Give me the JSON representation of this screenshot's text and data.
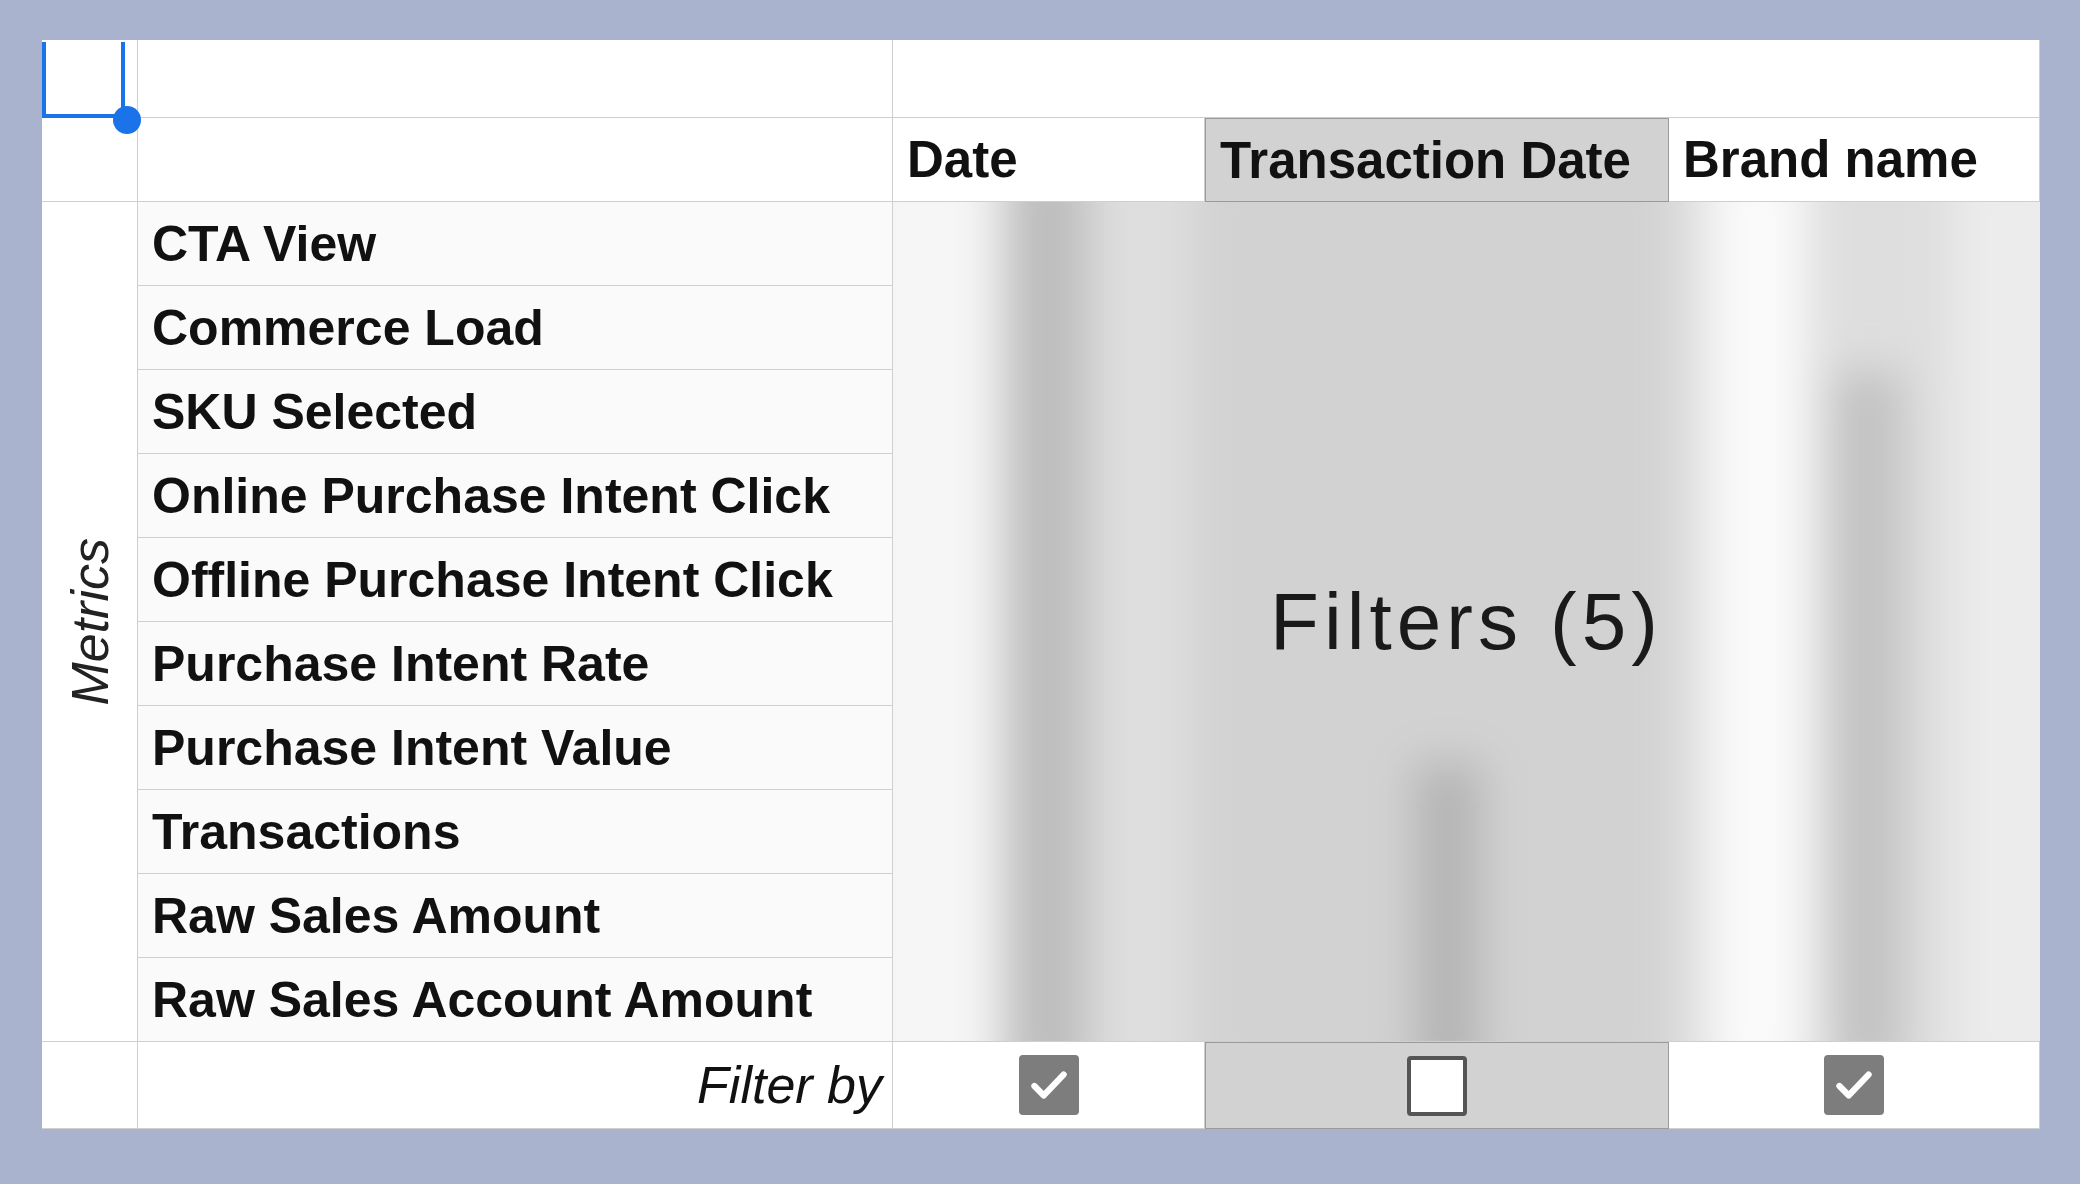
{
  "row_group": {
    "label": "Metrics"
  },
  "columns": [
    {
      "label": "Date",
      "selected": false,
      "filter_checked": true
    },
    {
      "label": "Transaction Date",
      "selected": true,
      "filter_checked": false
    },
    {
      "label": "Brand name",
      "selected": false,
      "filter_checked": true
    }
  ],
  "metrics": [
    "CTA View",
    "Commerce Load",
    "SKU Selected",
    "Online Purchase Intent Click",
    "Offline Purchase Intent Click",
    "Purchase Intent Rate",
    "Purchase Intent Value",
    "Transactions",
    "Raw Sales Amount",
    "Raw Sales Account Amount"
  ],
  "overlay": {
    "label": "Filters (5)"
  },
  "filter_row": {
    "label": "Filter by"
  }
}
